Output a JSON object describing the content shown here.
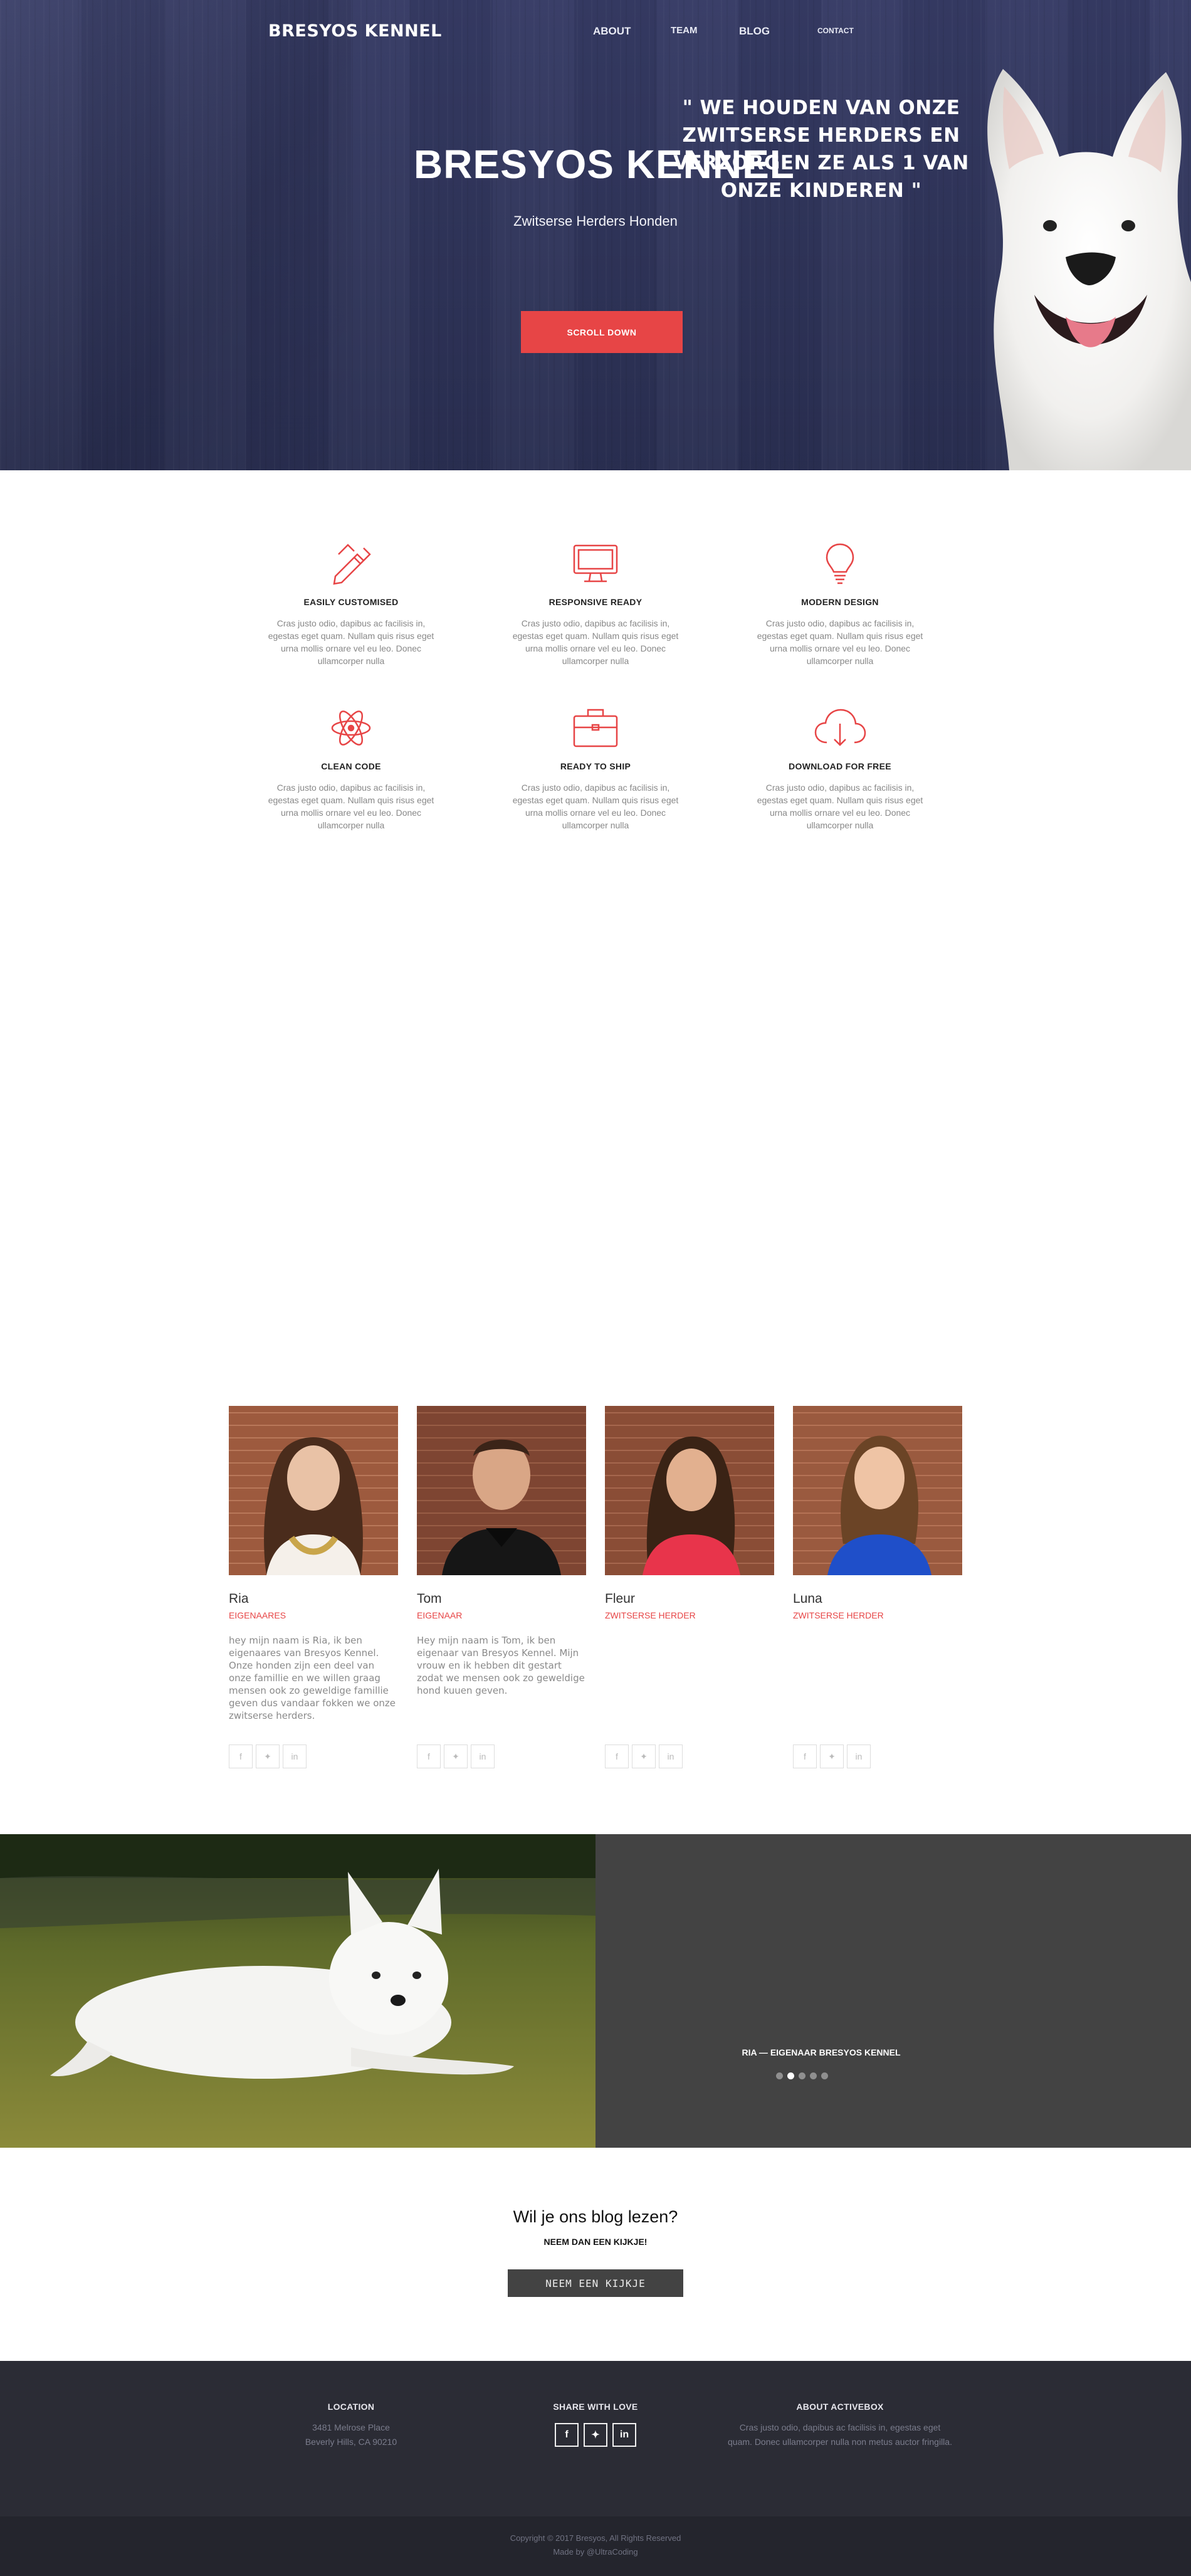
{
  "nav": {
    "brand": "BRESYOS KENNEL",
    "links": [
      "ABOUT",
      "TEAM",
      "BLOG",
      "CONTACT"
    ]
  },
  "hero": {
    "title": "BRESYOS KENNEL",
    "subtitle": "Zwitserse Herders Honden",
    "button": "SCROLL DOWN"
  },
  "features": [
    {
      "title": "EASILY CUSTOMISED",
      "text": "Cras justo odio, dapibus ac facilisis in, egestas eget quam. Nullam quis risus eget urna mollis ornare vel eu leo. Donec ullamcorper nulla",
      "icon": "pencil-ruler-icon"
    },
    {
      "title": "RESPONSIVE READY",
      "text": "Cras justo odio, dapibus ac facilisis in, egestas eget quam. Nullam quis risus eget urna mollis ornare vel eu leo. Donec ullamcorper nulla",
      "icon": "monitor-icon"
    },
    {
      "title": "MODERN DESIGN",
      "text": "Cras justo odio, dapibus ac facilisis in, egestas eget quam. Nullam quis risus eget urna mollis ornare vel eu leo. Donec ullamcorper nulla",
      "icon": "lightbulb-icon"
    },
    {
      "title": "CLEAN CODE",
      "text": "Cras justo odio, dapibus ac facilisis in, egestas eget quam. Nullam quis risus eget urna mollis ornare vel eu leo. Donec ullamcorper nulla",
      "icon": "atom-icon"
    },
    {
      "title": "READY TO SHIP",
      "text": "Cras justo odio, dapibus ac facilisis in, egestas eget quam. Nullam quis risus eget urna mollis ornare vel eu leo. Donec ullamcorper nulla",
      "icon": "briefcase-icon"
    },
    {
      "title": "DOWNLOAD FOR FREE",
      "text": "Cras justo odio, dapibus ac facilisis in, egestas eget quam. Nullam quis risus eget urna mollis ornare vel eu leo. Donec ullamcorper nulla",
      "icon": "cloud-download-icon"
    }
  ],
  "team": [
    {
      "name": "Ria",
      "role": "EIGENAARES",
      "bio": "hey mijn naam is Ria, ik ben eigenaares van Bresyos Kennel. Onze honden zijn een deel van onze famillie en we willen graag mensen ook zo geweldige famillie geven dus vandaar fokken we onze zwitserse herders."
    },
    {
      "name": "Tom",
      "role": "EIGENAAR",
      "bio": "Hey mijn naam is Tom, ik ben eigenaar van Bresyos Kennel. Mijn vrouw en ik hebben dit gestart zodat we mensen ook zo geweldige hond kuuen geven."
    },
    {
      "name": "Fleur",
      "role": "ZWITSERSE HERDER",
      "bio": ""
    },
    {
      "name": "Luna",
      "role": "ZWITSERSE HERDER",
      "bio": ""
    }
  ],
  "testimonial": {
    "quote": "\" WE HOUDEN VAN ONZE ZWITSERSE HERDERS EN VERZORGEN ZE ALS 1 VAN ONZE KINDEREN \"",
    "author": "RIA — EIGENAAR BRESYOS KENNEL",
    "slides": 5,
    "active_slide": 2
  },
  "blog": {
    "title": "Wil je ons blog lezen?",
    "subtitle": "NEEM DAN EEN KIJKJE!",
    "button": "NEEM EEN KIJKJE"
  },
  "footer": {
    "location_head": "LOCATION",
    "location_line1": "3481 Melrose Place",
    "location_line2": "Beverly Hills, CA 90210",
    "share_head": "SHARE WITH LOVE",
    "about_head": "ABOUT ACTIVEBOX",
    "about_text": "Cras justo odio, dapibus ac facilisis in, egestas eget quam. Donec ullamcorper nulla non metus auctor fringilla.",
    "copyright": "Copyright © 2017 Bresyos, All Rights Reserved",
    "made_by": "Made by @UltraCoding"
  },
  "colors": {
    "accent": "#e74546",
    "hero_bg": "#31365c",
    "dark_panel": "#434343",
    "footer_bg": "#2b2c35"
  }
}
